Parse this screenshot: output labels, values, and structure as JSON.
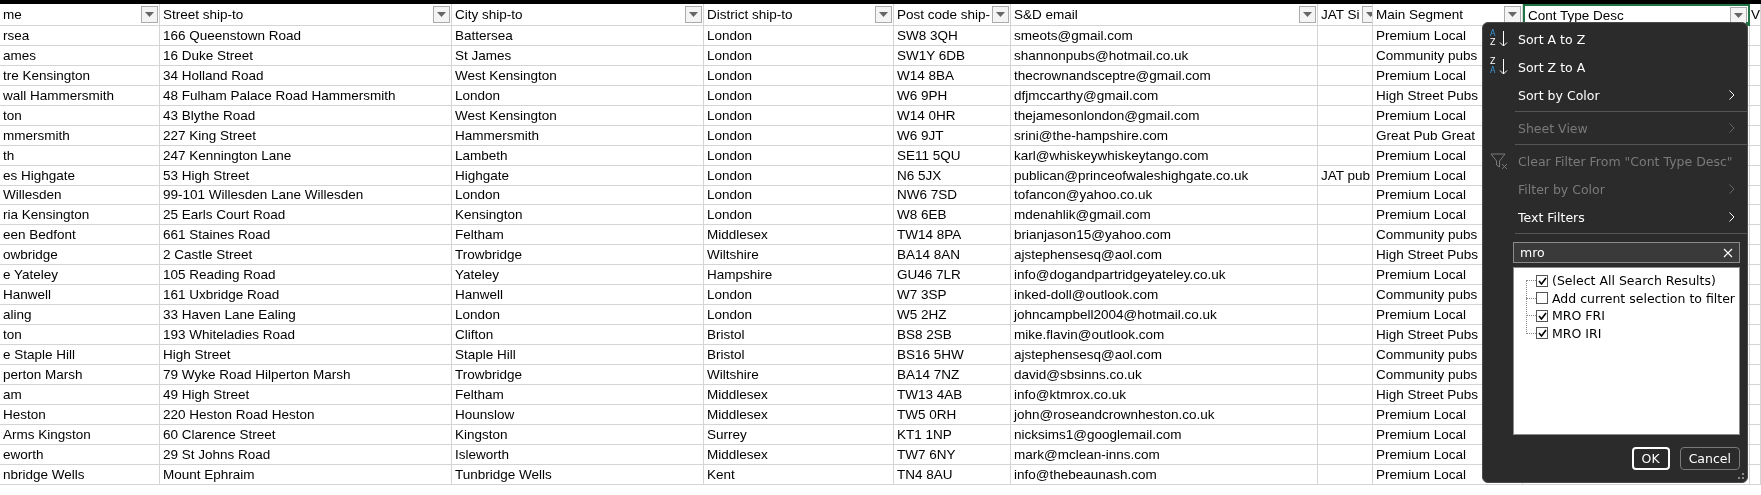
{
  "sheet": {
    "columns": [
      {
        "label": "me",
        "selected": false
      },
      {
        "label": "Street ship-to",
        "selected": false
      },
      {
        "label": "City ship-to",
        "selected": false
      },
      {
        "label": "District ship-to",
        "selected": false
      },
      {
        "label": "Post code ship-",
        "selected": false
      },
      {
        "label": "S&D email",
        "selected": false
      },
      {
        "label": "JAT Si",
        "selected": false
      },
      {
        "label": "Main Segment",
        "selected": false
      },
      {
        "label": "Cont Type Desc",
        "selected": true
      },
      {
        "label": "V",
        "selected": false
      }
    ],
    "rows": [
      {
        "name": "rsea",
        "street": "166 Queenstown Road",
        "city": "Battersea",
        "district": "London",
        "postcode": "SW8 3QH",
        "email": "smeots@gmail.com",
        "segment": "Premium Local"
      },
      {
        "name": "ames",
        "street": "16 Duke Street",
        "city": "St James",
        "district": "London",
        "postcode": "SW1Y 6DB",
        "email": "shannonpubs@hotmail.co.uk",
        "segment": "Community pubs"
      },
      {
        "name": "tre Kensington",
        "street": "34 Holland Road",
        "city": "West Kensington",
        "district": "London",
        "postcode": "W14 8BA",
        "email": "thecrownandsceptre@gmail.com",
        "segment": "Premium Local"
      },
      {
        "name": "wall Hammersmith",
        "street": "48 Fulham Palace Road Hammersmith",
        "city": "London",
        "district": "London",
        "postcode": "W6 9PH",
        "email": "dfjmccarthy@gmail.com",
        "segment": "High Street Pubs"
      },
      {
        "name": "ton",
        "street": "43 Blythe Road",
        "city": "West Kensington",
        "district": "London",
        "postcode": "W14 0HR",
        "email": "thejamesonlondon@gmail.com",
        "segment": "Premium Local"
      },
      {
        "name": "mmersmith",
        "street": "227 King Street",
        "city": "Hammersmith",
        "district": "London",
        "postcode": "W6 9JT",
        "email": "srini@the-hampshire.com",
        "segment": "Great Pub Great"
      },
      {
        "name": "th",
        "street": "247 Kennington Lane",
        "city": "Lambeth",
        "district": "London",
        "postcode": "SE11 5QU",
        "email": "karl@whiskeywhiskeytango.com",
        "segment": "Premium Local"
      },
      {
        "name": "es Highgate",
        "street": "53 High Street",
        "city": "Highgate",
        "district": "London",
        "postcode": "N6 5JX",
        "email": "publican@princeofwaleshighgate.co.uk",
        "jat": "JAT pub",
        "segment": "Premium Local"
      },
      {
        "name": "Willesden",
        "street": "99-101 Willesden Lane Willesden",
        "city": "London",
        "district": "London",
        "postcode": "NW6 7SD",
        "email": "tofancon@yahoo.co.uk",
        "segment": "Premium Local"
      },
      {
        "name": "ria Kensington",
        "street": "25 Earls Court Road",
        "city": "Kensington",
        "district": "London",
        "postcode": "W8 6EB",
        "email": "mdenahlik@gmail.com",
        "segment": "Premium Local"
      },
      {
        "name": "een Bedfont",
        "street": "661 Staines Road",
        "city": "Feltham",
        "district": "Middlesex",
        "postcode": "TW14 8PA",
        "email": "brianjason15@yahoo.com",
        "segment": "Community pubs"
      },
      {
        "name": "owbridge",
        "street": "2 Castle Street",
        "city": "Trowbridge",
        "district": "Wiltshire",
        "postcode": "BA14 8AN",
        "email": "ajstephensesq@aol.com",
        "segment": "High Street Pubs"
      },
      {
        "name": "e Yateley",
        "street": "105 Reading Road",
        "city": "Yateley",
        "district": "Hampshire",
        "postcode": "GU46 7LR",
        "email": "info@dogandpartridgeyateley.co.uk",
        "segment": "Premium Local"
      },
      {
        "name": "Hanwell",
        "street": "161 Uxbridge Road",
        "city": "Hanwell",
        "district": "London",
        "postcode": "W7 3SP",
        "email": "inked-doll@outlook.com",
        "segment": "Community pubs"
      },
      {
        "name": "aling",
        "street": "33 Haven Lane Ealing",
        "city": "London",
        "district": "London",
        "postcode": "W5 2HZ",
        "email": "johncampbell2004@hotmail.co.uk",
        "segment": "Premium Local"
      },
      {
        "name": "ton",
        "street": "193 Whiteladies Road",
        "city": "Clifton",
        "district": "Bristol",
        "postcode": "BS8 2SB",
        "email": "mike.flavin@outlook.com",
        "segment": "High Street Pubs"
      },
      {
        "name": "e Staple Hill",
        "street": "High Street",
        "city": "Staple Hill",
        "district": "Bristol",
        "postcode": "BS16 5HW",
        "email": "ajstephensesq@aol.com",
        "segment": "Community pubs"
      },
      {
        "name": "perton Marsh",
        "street": "79 Wyke Road Hilperton Marsh",
        "city": "Trowbridge",
        "district": "Wiltshire",
        "postcode": "BA14 7NZ",
        "email": "david@sbsinns.co.uk",
        "segment": "Community pubs"
      },
      {
        "name": "am",
        "street": "49 High Street",
        "city": "Feltham",
        "district": "Middlesex",
        "postcode": "TW13 4AB",
        "email": "info@ktmrox.co.uk",
        "segment": "High Street Pubs"
      },
      {
        "name": "Heston",
        "street": "220 Heston Road Heston",
        "city": "Hounslow",
        "district": "Middlesex",
        "postcode": "TW5 0RH",
        "email": "john@roseandcrownheston.co.uk",
        "segment": "Premium Local"
      },
      {
        "name": "Arms Kingston",
        "street": "60 Clarence Street",
        "city": "Kingston",
        "district": "Surrey",
        "postcode": "KT1 1NP",
        "email": "nicksims1@googlemail.com",
        "segment": "Premium Local"
      },
      {
        "name": "eworth",
        "street": "29 St Johns Road",
        "city": "Isleworth",
        "district": "Middlesex",
        "postcode": "TW7 6NY",
        "email": "mark@mclean-inns.com",
        "segment": "Premium Local"
      },
      {
        "name": "nbridge Wells",
        "street": "Mount Ephraim",
        "city": "Tunbridge Wells",
        "district": "Kent",
        "postcode": "TN4 8AU",
        "email": "info@thebeaunash.com",
        "segment": "Premium Local"
      }
    ]
  },
  "filter_menu": {
    "items": [
      {
        "kind": "sort_asc",
        "label": "Sort A to Z",
        "icon_top": "A",
        "icon_bottom": "Z",
        "disabled": false,
        "submenu": false
      },
      {
        "kind": "sort_desc",
        "label": "Sort Z to A",
        "icon_top": "Z",
        "icon_bottom": "A",
        "disabled": false,
        "submenu": false
      },
      {
        "kind": "plain",
        "label": "Sort by Color",
        "disabled": false,
        "submenu": true
      },
      {
        "kind": "separator"
      },
      {
        "kind": "plain",
        "label": "Sheet View",
        "disabled": true,
        "submenu": true
      },
      {
        "kind": "separator"
      },
      {
        "kind": "clear_filter",
        "label": "Clear Filter From \"Cont Type Desc\"",
        "disabled": true,
        "submenu": false
      },
      {
        "kind": "plain",
        "label": "Filter by Color",
        "disabled": true,
        "submenu": true
      },
      {
        "kind": "plain",
        "label": "Text Filters",
        "disabled": false,
        "submenu": true
      },
      {
        "kind": "separator"
      }
    ],
    "search": {
      "value": "mro"
    },
    "values": [
      {
        "label": "(Select All Search Results)",
        "checked": true
      },
      {
        "label": "Add current selection to filter",
        "checked": false
      },
      {
        "label": "MRO FRI",
        "checked": true
      },
      {
        "label": "MRO IRI",
        "checked": true
      }
    ],
    "buttons": [
      {
        "label": "OK",
        "focused": true
      },
      {
        "label": "Cancel",
        "focused": false
      }
    ]
  }
}
